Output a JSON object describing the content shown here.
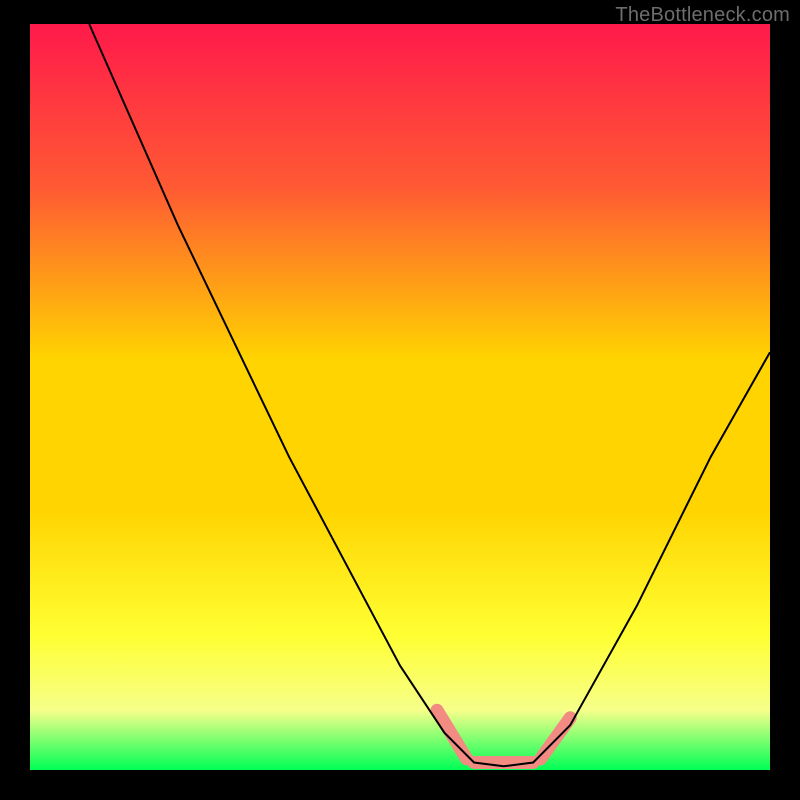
{
  "watermark": {
    "text": "TheBottleneck.com"
  },
  "chart_data": {
    "type": "line",
    "title": "",
    "xlabel": "",
    "ylabel": "",
    "xlim": [
      0,
      100
    ],
    "ylim": [
      0,
      100
    ],
    "grid": false,
    "legend": false,
    "background_gradient": {
      "top": "#ff1a4b",
      "mid1": "#ff6a2a",
      "mid2": "#ffd400",
      "mid3": "#ffff33",
      "mid4": "#f6ff8a",
      "bottom": "#00ff55"
    },
    "curve": {
      "description": "V-shaped curve with minimum flat region near x≈60-68, rising steeply on both sides",
      "points": [
        {
          "x": 8,
          "y": 100
        },
        {
          "x": 20,
          "y": 73
        },
        {
          "x": 35,
          "y": 42
        },
        {
          "x": 50,
          "y": 14
        },
        {
          "x": 56,
          "y": 5
        },
        {
          "x": 60,
          "y": 1
        },
        {
          "x": 64,
          "y": 0.5
        },
        {
          "x": 68,
          "y": 1
        },
        {
          "x": 73,
          "y": 6
        },
        {
          "x": 82,
          "y": 22
        },
        {
          "x": 92,
          "y": 42
        },
        {
          "x": 100,
          "y": 56
        }
      ]
    },
    "highlight_band": {
      "description": "Soft red thick segments near the trough on both descending and ascending arms",
      "color": "#f28b82",
      "segments": [
        {
          "x1": 55,
          "y1": 8,
          "x2": 59,
          "y2": 1.5
        },
        {
          "x1": 60,
          "y1": 1,
          "x2": 68,
          "y2": 1
        },
        {
          "x1": 69,
          "y1": 1.5,
          "x2": 73,
          "y2": 7
        }
      ]
    }
  }
}
